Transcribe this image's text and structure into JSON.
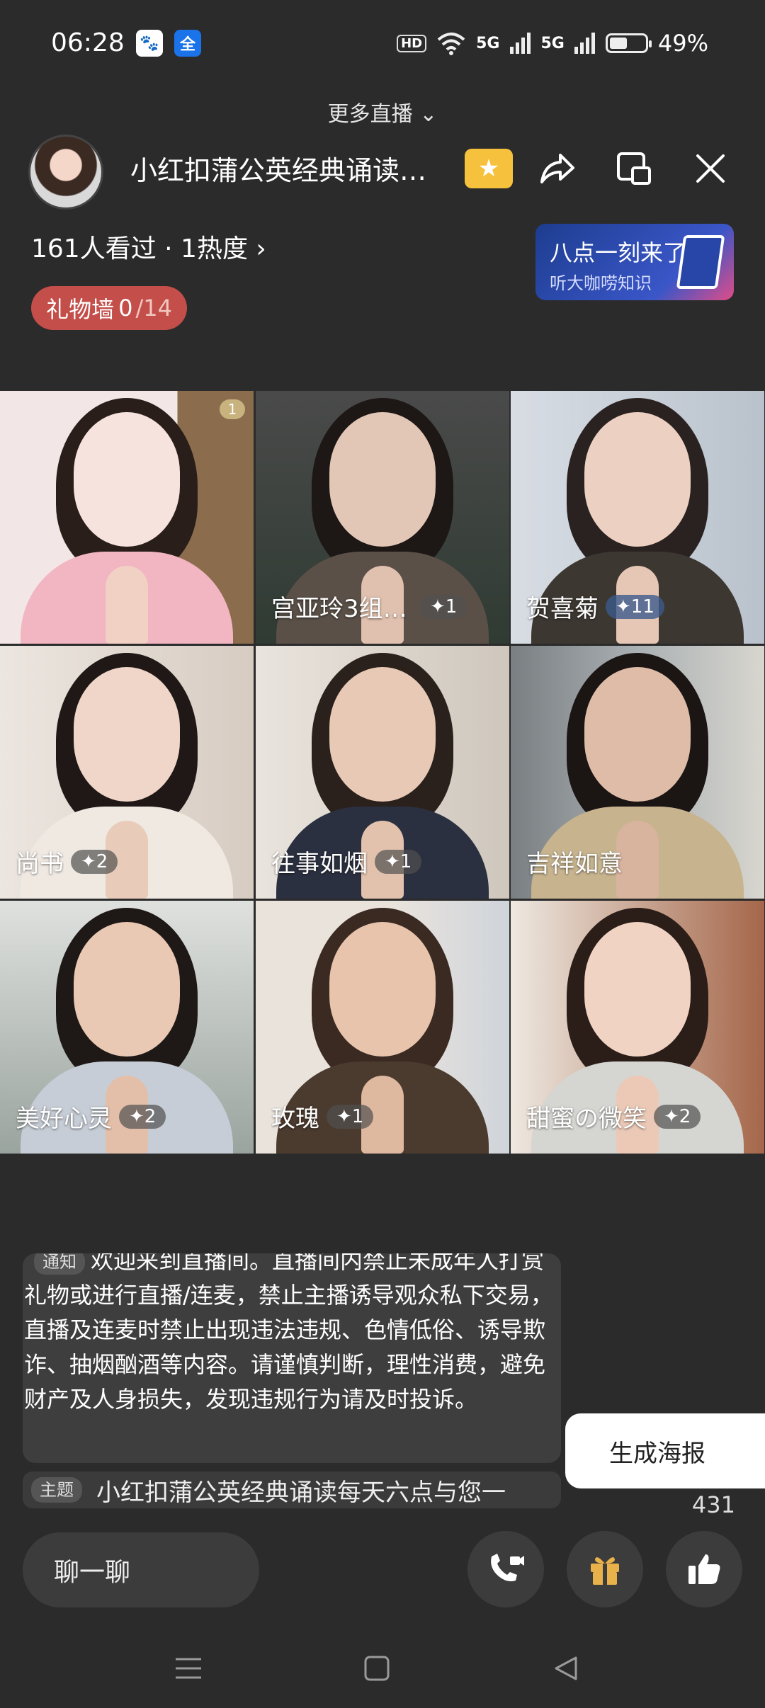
{
  "status_bar": {
    "time": "06:28",
    "hd_label": "HD",
    "signal1": "5G",
    "signal2": "5G",
    "battery": "49%",
    "battery_level": 0.49,
    "app_icon_2": "全"
  },
  "header": {
    "more_live": "更多直播 ⌄",
    "room_title": "小红扣蒲公英经典诵读每天六点与您一",
    "viewers": "161人看过 · 1热度 ›",
    "gift_wall_label": "礼物墙",
    "gift_wall_count": "0",
    "gift_wall_total": "/14",
    "ad_title": "八点一刻来了",
    "ad_subtitle": "听大咖唠知识"
  },
  "tiles": [
    {
      "name": "",
      "count": "",
      "seat_badge": "1"
    },
    {
      "name": "宫亚玲3组1...",
      "count": "✦1"
    },
    {
      "name": "贺喜菊",
      "count": "✦11"
    },
    {
      "name": "尚书",
      "count": "✦2"
    },
    {
      "name": "往事如烟",
      "count": "✦1"
    },
    {
      "name": "吉祥如意",
      "count": ""
    },
    {
      "name": "美好心灵",
      "count": "✦2"
    },
    {
      "name": "玫瑰",
      "count": "✦1"
    },
    {
      "name": "甜蜜の微笑",
      "count": "✦2"
    }
  ],
  "chat": {
    "notice_tag": "通知",
    "notice_text": "欢迎来到直播间。直播间内禁止未成年人打赏礼物或进行直播/连麦，禁止主播诱导观众私下交易，直播及连麦时禁止出现违法违规、色情低俗、诱导欺诈、抽烟酗酒等内容。请谨慎判断，理性消费，避免财产及人身损失，发现违规行为请及时投诉。",
    "topic_tag": "主题",
    "topic_text": "小红扣蒲公英经典诵读每天六点与您一"
  },
  "actions": {
    "poster": "生成海报",
    "like_count": "431",
    "chat_placeholder": "聊一聊"
  },
  "colors": {
    "gift_wall": "#c34e4a",
    "favorite": "#f6c23e",
    "background": "#2b2b2b"
  }
}
